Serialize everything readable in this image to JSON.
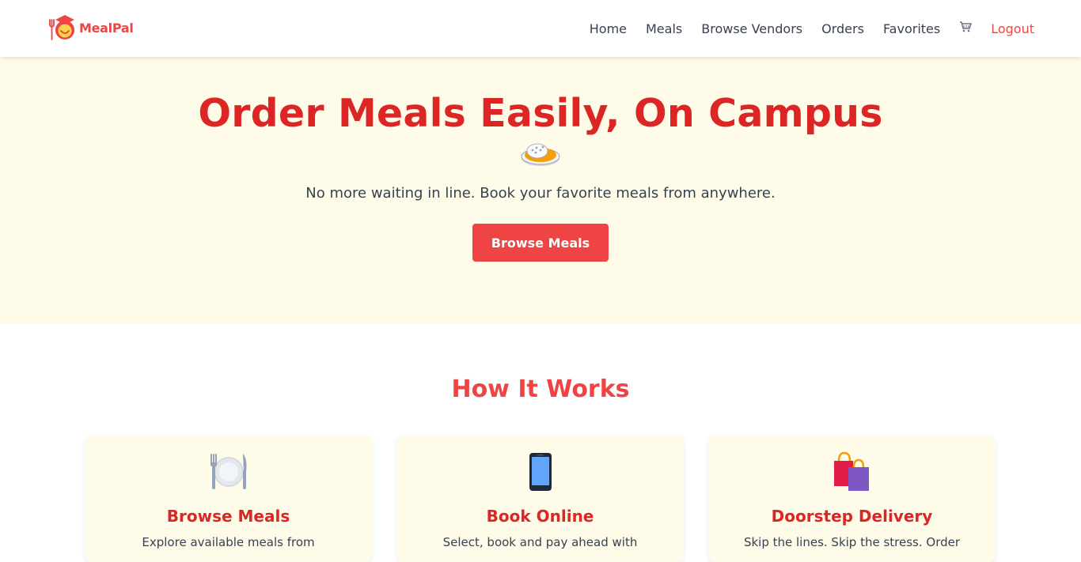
{
  "navbar": {
    "brand": "MealPal",
    "links": [
      "Home",
      "Meals",
      "Browse Vendors",
      "Orders",
      "Favorites"
    ],
    "cart_icon": "cart-icon",
    "logout": "Logout"
  },
  "hero": {
    "title": "Order Meals Easily, On Campus",
    "emoji_icon": "rice-plate-icon",
    "subtitle": "No more waiting in line. Book your favorite meals from anywhere.",
    "button": "Browse Meals"
  },
  "how_it_works": {
    "title": "How It Works",
    "cards": [
      {
        "icon": "fork-knife-plate-icon",
        "title": "Browse Meals",
        "desc": "Explore available meals from"
      },
      {
        "icon": "mobile-phone-icon",
        "title": "Book Online",
        "desc": "Select, book and pay ahead with"
      },
      {
        "icon": "shopping-bags-icon",
        "title": "Doorstep Delivery",
        "desc": "Skip the lines. Skip the stress. Order"
      }
    ]
  },
  "colors": {
    "brand": "#ef4444",
    "title_red": "#dc2626",
    "hero_bg": "#fefbe8",
    "text": "#374151"
  }
}
